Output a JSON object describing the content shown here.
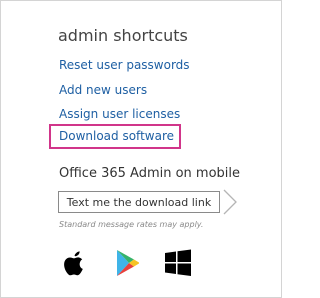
{
  "section": {
    "title": "admin shortcuts"
  },
  "shortcuts": [
    {
      "label": "Reset user passwords"
    },
    {
      "label": "Add new users"
    },
    {
      "label": "Assign user licenses"
    },
    {
      "label": "Download software"
    }
  ],
  "mobile": {
    "title": "Office 365 Admin on mobile",
    "button_label": "Text me the download link",
    "disclaimer": "Standard message rates may apply."
  },
  "stores": [
    {
      "icon": "apple-icon"
    },
    {
      "icon": "google-play-icon"
    },
    {
      "icon": "windows-icon"
    }
  ],
  "colors": {
    "link": "#1e5fa3",
    "highlight": "#d1358a",
    "text": "#444444"
  }
}
